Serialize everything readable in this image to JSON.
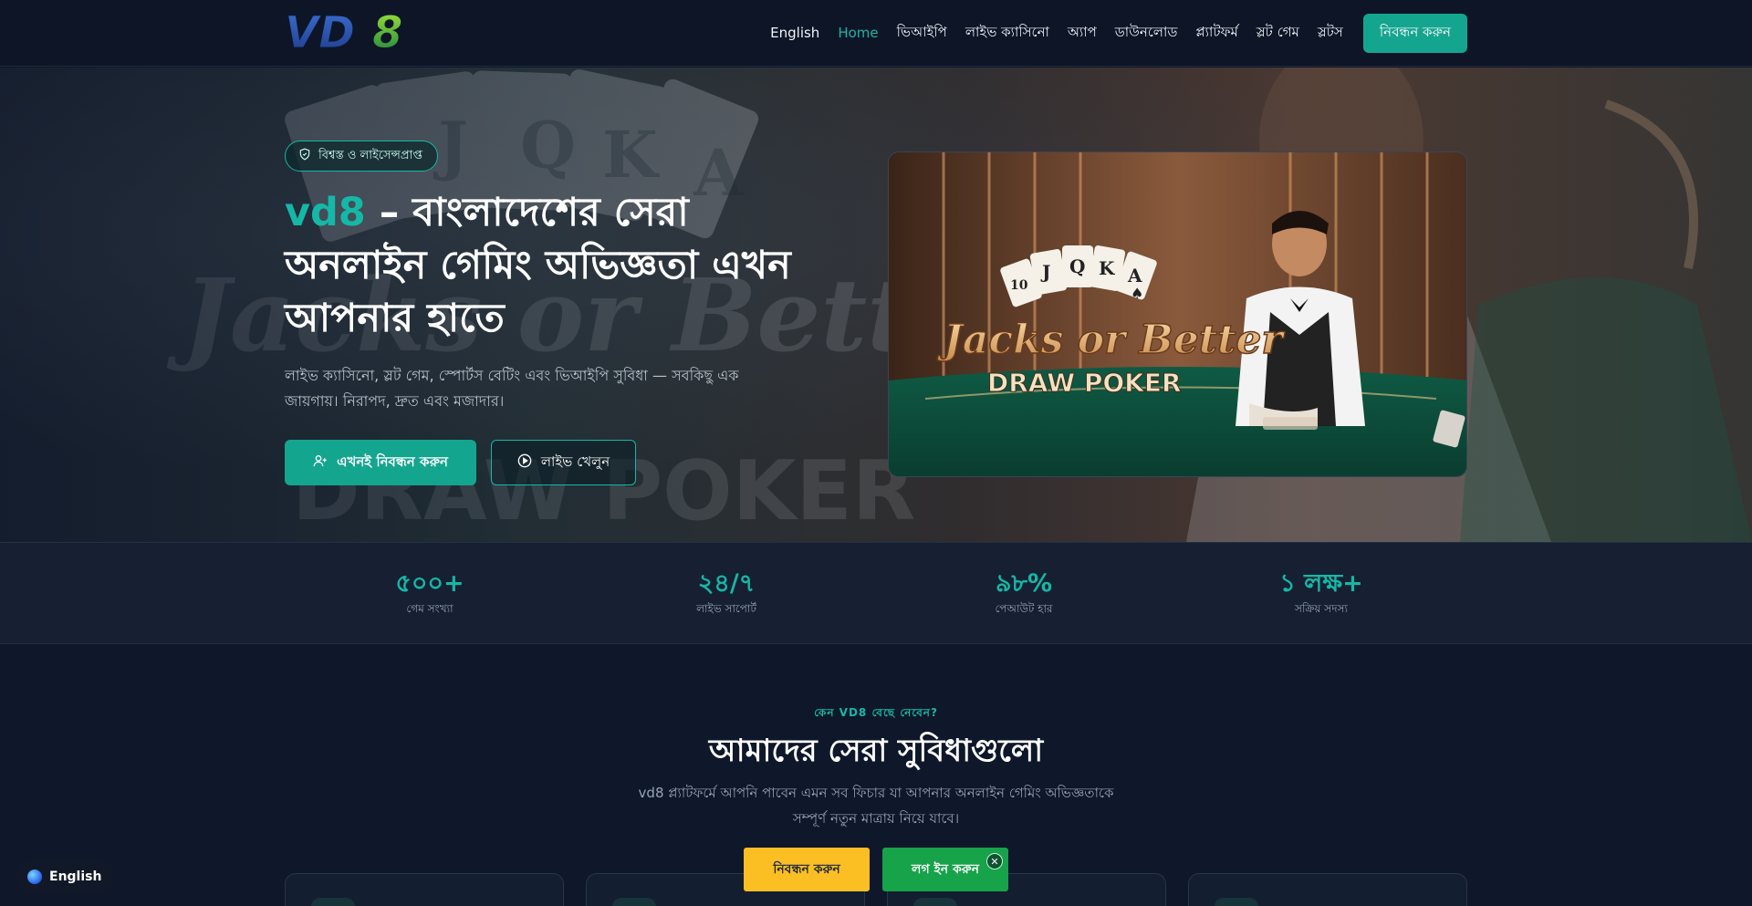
{
  "header": {
    "logo_text": "VD8",
    "nav": [
      {
        "label": "English"
      },
      {
        "label": "Home",
        "active": true
      },
      {
        "label": "ভিআইপি"
      },
      {
        "label": "লাইভ ক্যাসিনো"
      },
      {
        "label": "অ্যাপ"
      },
      {
        "label": "ডাউনলোড"
      },
      {
        "label": "প্ল্যাটফর্ম"
      },
      {
        "label": "স্লট গেম"
      },
      {
        "label": "স্লটস"
      }
    ],
    "register_label": "নিবন্ধন করুন"
  },
  "hero": {
    "badge": "বিশ্বস্ত ও লাইসেন্সপ্রাপ্ত",
    "title_brand": "vd8",
    "title_rest": " – বাংলাদেশের সেরা অনলাইন গেমিং অভিজ্ঞতা এখন আপনার হাতে",
    "subtitle": "লাইভ ক্যাসিনো, স্লট গেম, স্পোর্টস বেটিং এবং ভিআইপি সুবিধা — সবকিছু এক জায়গায়। নিরাপদ, দ্রুত এবং মজাদার।",
    "primary_button": "এখনই নিবন্ধন করুন",
    "secondary_button": "লাইভ খেলুন",
    "image_caption_line1": "Jacks or Better",
    "image_caption_line2": "DRAW POKER",
    "cards": [
      "10",
      "J",
      "Q",
      "K",
      "A",
      "♠"
    ]
  },
  "stats": [
    {
      "value": "৫০০+",
      "label": "গেম সংখ্যা"
    },
    {
      "value": "২৪/৭",
      "label": "লাইভ সাপোর্ট"
    },
    {
      "value": "৯৮%",
      "label": "পেআউট হার"
    },
    {
      "value": "১ লক্ষ+",
      "label": "সক্রিয় সদস্য"
    }
  ],
  "features": {
    "eyebrow": "কেন VD8 বেছে নেবেন?",
    "title": "আমাদের সেরা সুবিধাগুলো",
    "description": "vd8 প্ল্যাটফর্মে আপনি পাবেন এমন সব ফিচার যা আপনার অনলাইন গেমিং অভিজ্ঞতাকে সম্পূর্ণ নতুন মাত্রায় নিয়ে যাবে।"
  },
  "floating": {
    "language": "English",
    "register": "নিবন্ধন করুন",
    "login": "লগ ইন করুন",
    "close": "✕"
  },
  "colors": {
    "accent": "#14b8a6",
    "background": "#0f172a",
    "register_float": "#fbbf24",
    "login_float": "#16a34a"
  }
}
